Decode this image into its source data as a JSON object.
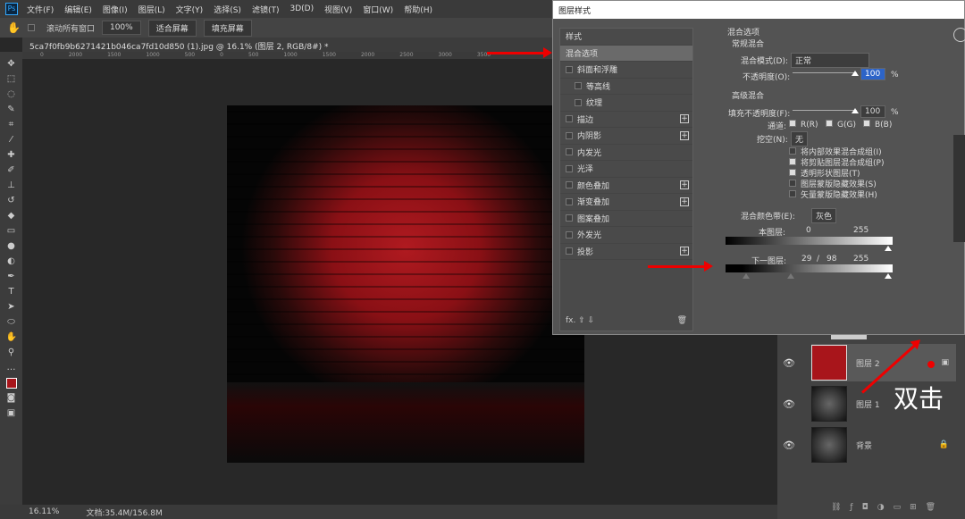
{
  "menubar": {
    "logo": "Ps",
    "items": [
      "文件(F)",
      "编辑(E)",
      "图像(I)",
      "图层(L)",
      "文字(Y)",
      "选择(S)",
      "滤镜(T)",
      "3D(D)",
      "视图(V)",
      "窗口(W)",
      "帮助(H)"
    ]
  },
  "options": {
    "scroll_all": "滚动所有窗口",
    "zoom": "100%",
    "fit": "适合屏幕",
    "fill": "填充屏幕"
  },
  "document": {
    "tab": "5ca7f0fb9b6271421b046ca7fd10d850 (1).jpg @ 16.1% (图层 2, RGB/8#) *",
    "ruler": [
      "0",
      "2000",
      "1500",
      "1000",
      "500",
      "0",
      "500",
      "1000",
      "1500",
      "2000",
      "2500",
      "3000",
      "3500"
    ]
  },
  "status": {
    "zoom": "16.11%",
    "doc": "文档:35.4M/156.8M"
  },
  "dialog": {
    "title": "图层样式",
    "styles_header": "样式",
    "items": [
      {
        "label": "混合选项",
        "selected": true
      },
      {
        "label": "斜面和浮雕",
        "checkbox": true
      },
      {
        "label": "等高线",
        "checkbox": true,
        "indent": true
      },
      {
        "label": "纹理",
        "checkbox": true,
        "indent": true
      },
      {
        "label": "描边",
        "checkbox": true,
        "plus": true
      },
      {
        "label": "内阴影",
        "checkbox": true,
        "plus": true
      },
      {
        "label": "内发光",
        "checkbox": true
      },
      {
        "label": "光泽",
        "checkbox": true
      },
      {
        "label": "颜色叠加",
        "checkbox": true,
        "plus": true
      },
      {
        "label": "渐变叠加",
        "checkbox": true,
        "plus": true
      },
      {
        "label": "图案叠加",
        "checkbox": true
      },
      {
        "label": "外发光",
        "checkbox": true
      },
      {
        "label": "投影",
        "checkbox": true,
        "plus": true
      }
    ],
    "fx": "fx.",
    "blend": {
      "section": "混合选项",
      "general": "常规混合",
      "mode_label": "混合模式(D):",
      "mode": "正常",
      "opacity_label": "不透明度(O):",
      "opacity": "100",
      "pct": "%",
      "advanced": "高级混合",
      "fill_label": "填充不透明度(F):",
      "fill": "100",
      "channels_label": "通道:",
      "r": "R(R)",
      "g": "G(G)",
      "b": "B(B)",
      "knockout_label": "挖空(N):",
      "knockout": "无",
      "options": [
        {
          "label": "将内部效果混合成组(I)",
          "checked": false
        },
        {
          "label": "将剪贴图层混合成组(P)",
          "checked": true
        },
        {
          "label": "透明形状图层(T)",
          "checked": true
        },
        {
          "label": "图层蒙版隐藏效果(S)",
          "checked": false
        },
        {
          "label": "矢量蒙版隐藏效果(H)",
          "checked": false
        }
      ],
      "blend_if_label": "混合颜色带(E):",
      "blend_if": "灰色",
      "this_layer": "本图层:",
      "this_low": "0",
      "this_high": "255",
      "under_layer": "下一图层:",
      "under_low": "29",
      "slash": "/",
      "under_mid": "98",
      "under_high": "255"
    }
  },
  "layers": [
    {
      "name": "图层 2",
      "color": "#a8151b",
      "selected": true
    },
    {
      "name": "图层 1"
    },
    {
      "name": "背景",
      "locked": true
    }
  ],
  "annotation": {
    "text": "双击",
    "arrow_color": "#e00000"
  }
}
